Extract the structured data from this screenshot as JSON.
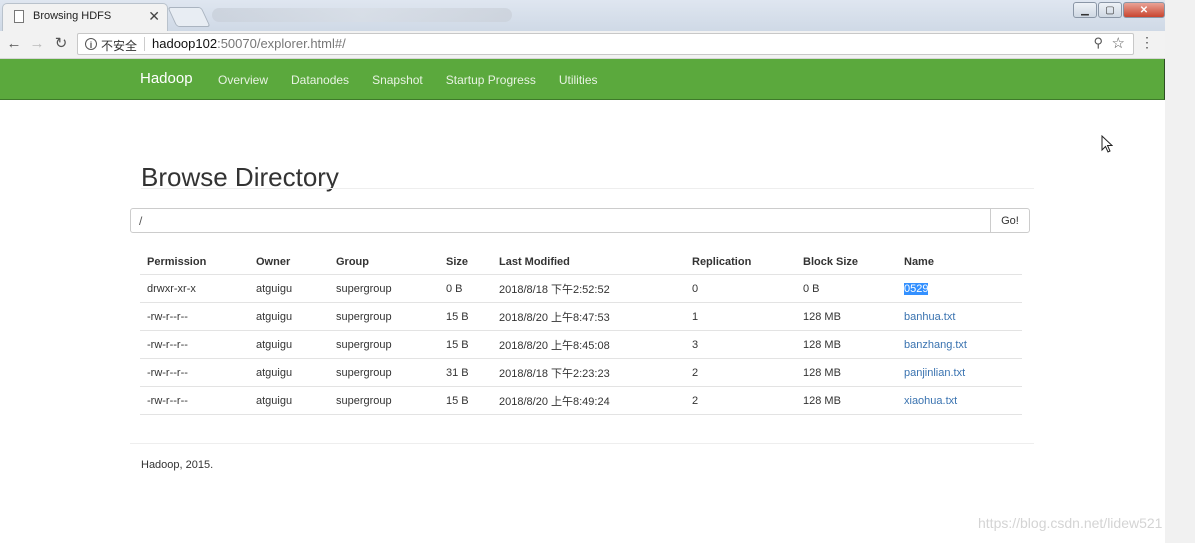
{
  "browser": {
    "tab_title": "Browsing HDFS",
    "tab_close": "✕",
    "insecure_label": "不安全",
    "url_host": "hadoop102",
    "url_rest": ":50070/explorer.html#/"
  },
  "navbar": {
    "brand": "Hadoop",
    "links": [
      "Overview",
      "Datanodes",
      "Snapshot",
      "Startup Progress",
      "Utilities"
    ]
  },
  "page": {
    "title": "Browse Directory",
    "path_value": "/",
    "go_label": "Go!",
    "footer": "Hadoop, 2015.",
    "watermark": "https://blog.csdn.net/lidew521"
  },
  "table": {
    "headers": [
      "Permission",
      "Owner",
      "Group",
      "Size",
      "Last Modified",
      "Replication",
      "Block Size",
      "Name"
    ],
    "rows": [
      [
        "drwxr-xr-x",
        "atguigu",
        "supergroup",
        "0 B",
        "2018/8/18 下午2:52:52",
        "0",
        "0 B",
        "0529"
      ],
      [
        "-rw-r--r--",
        "atguigu",
        "supergroup",
        "15 B",
        "2018/8/20 上午8:47:53",
        "1",
        "128 MB",
        "banhua.txt"
      ],
      [
        "-rw-r--r--",
        "atguigu",
        "supergroup",
        "15 B",
        "2018/8/20 上午8:45:08",
        "3",
        "128 MB",
        "banzhang.txt"
      ],
      [
        "-rw-r--r--",
        "atguigu",
        "supergroup",
        "31 B",
        "2018/8/18 下午2:23:23",
        "2",
        "128 MB",
        "panjinlian.txt"
      ],
      [
        "-rw-r--r--",
        "atguigu",
        "supergroup",
        "15 B",
        "2018/8/20 上午8:49:24",
        "2",
        "128 MB",
        "xiaohua.txt"
      ]
    ]
  },
  "colors": {
    "navbar_green": "#5ba93d",
    "link_blue": "#3a73b0",
    "selection_blue": "#3390ff"
  }
}
